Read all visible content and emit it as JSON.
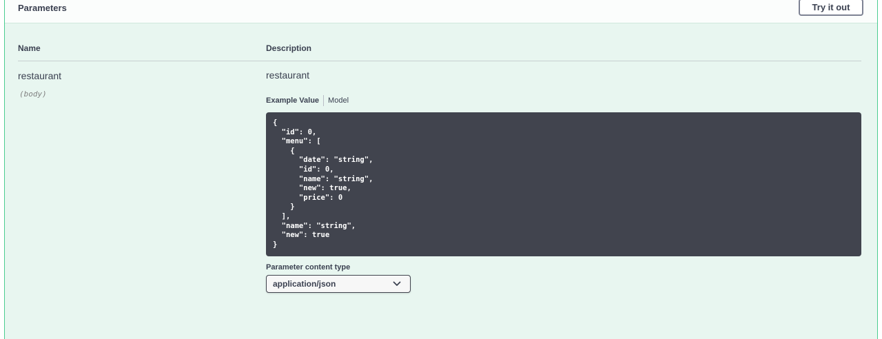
{
  "header": {
    "title": "Parameters",
    "try_button": "Try it out"
  },
  "table": {
    "columns": [
      "Name",
      "Description"
    ]
  },
  "parameter": {
    "name": "restaurant",
    "in": "(body)",
    "description": "restaurant",
    "tabs": [
      "Example Value",
      "Model"
    ],
    "active_tab": "Example Value",
    "example_value": "{\n  \"id\": 0,\n  \"menu\": [\n    {\n      \"date\": \"string\",\n      \"id\": 0,\n      \"name\": \"string\",\n      \"new\": true,\n      \"price\": 0\n    }\n  ],\n  \"name\": \"string\",\n  \"new\": true\n}",
    "content_type_label": "Parameter content type",
    "content_type": "application/json"
  },
  "icons": {
    "select_arrow": "chevron-down-icon"
  },
  "colors": {
    "panel_background": "#e8f6f0",
    "panel_border": "#49cc90",
    "code_background": "#41444e"
  }
}
